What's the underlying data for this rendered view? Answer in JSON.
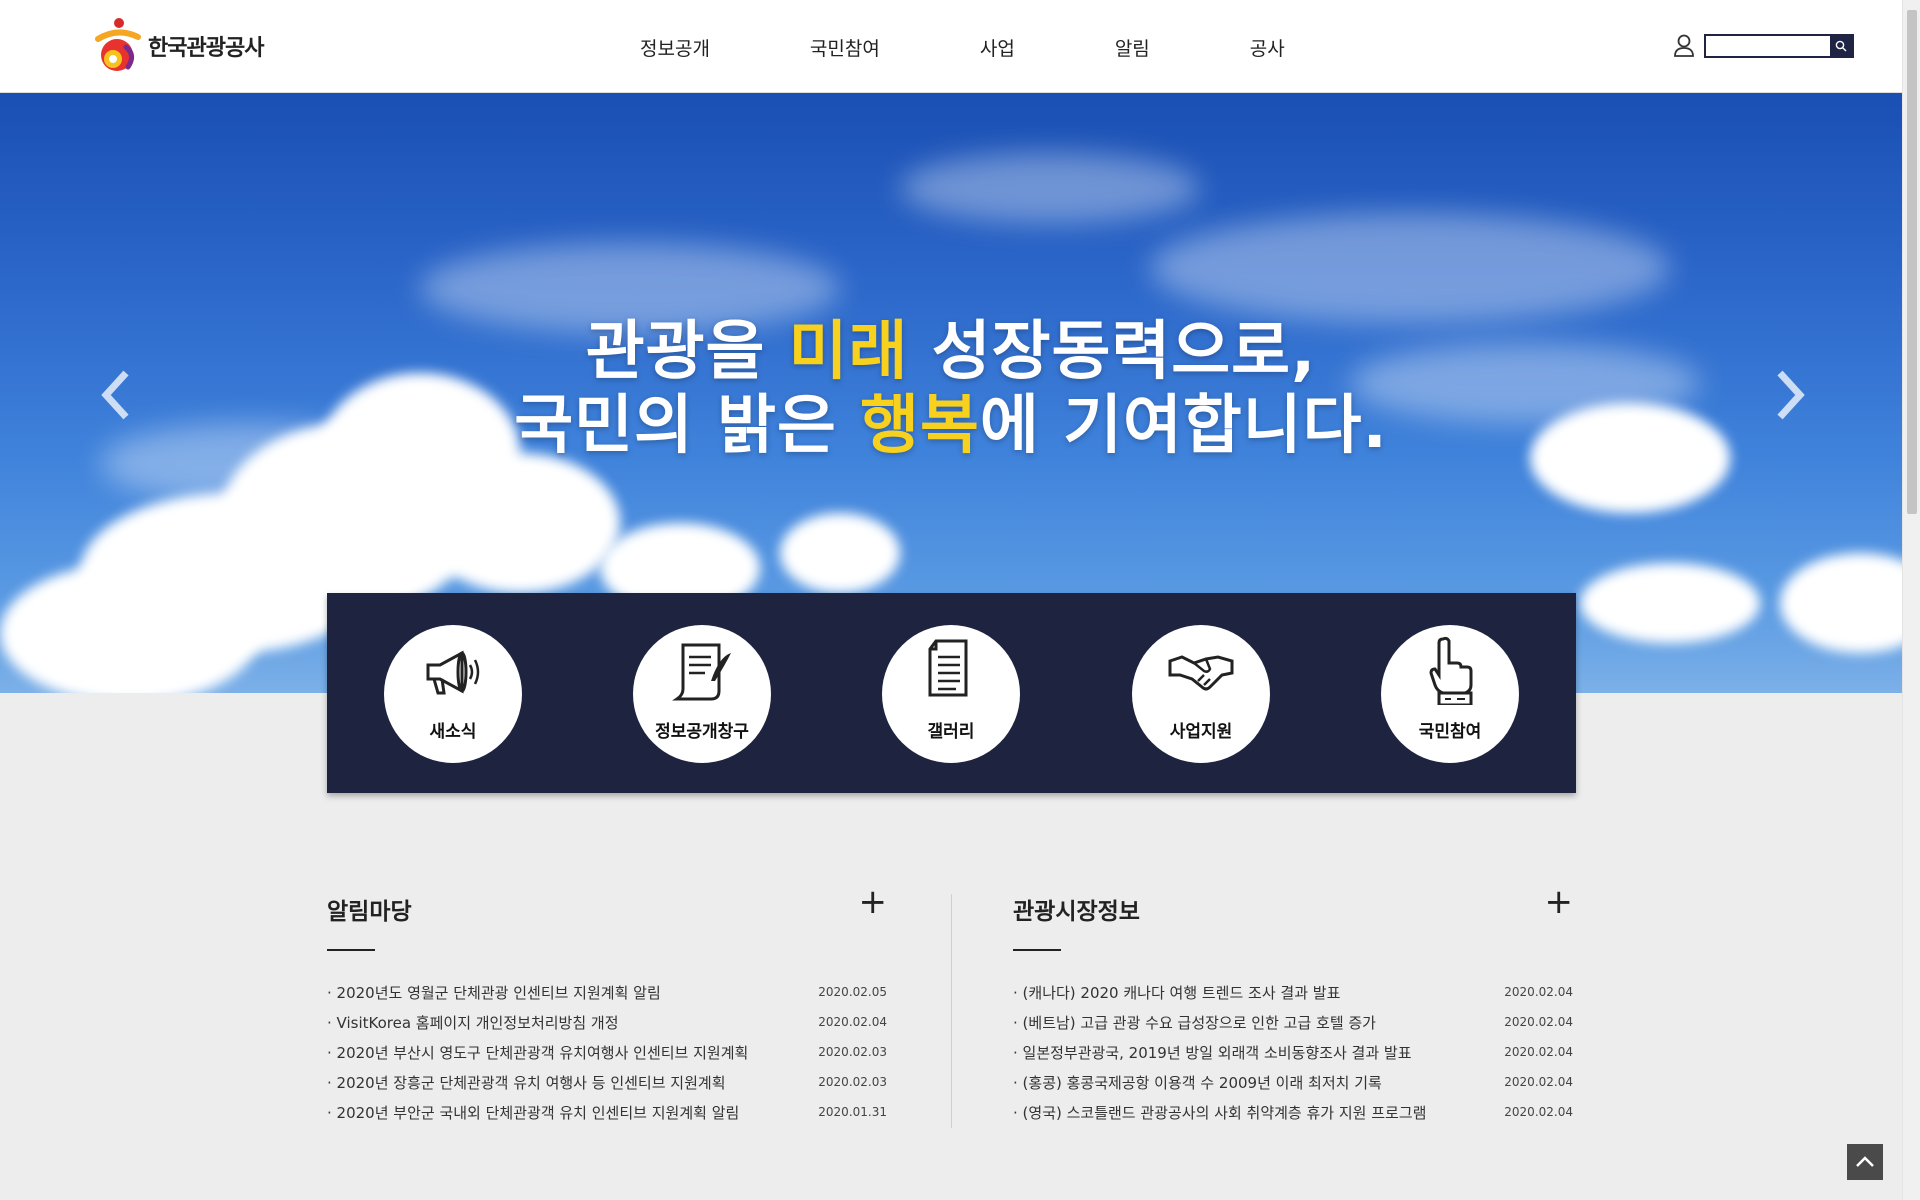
{
  "header": {
    "logo_text": "한국관광공사",
    "nav": [
      "정보공개",
      "국민참여",
      "사업",
      "알림",
      "공사"
    ],
    "search_placeholder": ""
  },
  "hero": {
    "line1_a": "관광을 ",
    "line1_hl": "미래",
    "line1_b": " 성장동력으로,",
    "line2_a": "국민의 밝은 ",
    "line2_hl": "행복",
    "line2_b": "에 기여합니다."
  },
  "quick_menu": [
    {
      "label": "새소식",
      "icon": "megaphone-icon"
    },
    {
      "label": "정보공개창구",
      "icon": "scroll-quill-icon"
    },
    {
      "label": "갤러리",
      "icon": "document-icon"
    },
    {
      "label": "사업지원",
      "icon": "handshake-icon"
    },
    {
      "label": "국민참여",
      "icon": "pointing-hand-icon"
    }
  ],
  "notice_board": {
    "title": "알림마당",
    "plus": "+",
    "items": [
      {
        "title": "· 2020년도 영월군 단체관광 인센티브 지원계획 알림",
        "date": "2020.02.05"
      },
      {
        "title": "· VisitKorea 홈페이지 개인정보처리방침 개정",
        "date": "2020.02.04"
      },
      {
        "title": "· 2020년 부산시 영도구 단체관광객 유치여행사 인센티브 지원계획",
        "date": "2020.02.03"
      },
      {
        "title": "· 2020년 장흥군 단체관광객 유치 여행사 등 인센티브 지원계획",
        "date": "2020.02.03"
      },
      {
        "title": "· 2020년 부안군 국내외 단체관광객 유치 인센티브 지원계획 알림",
        "date": "2020.01.31"
      }
    ]
  },
  "market_board": {
    "title": "관광시장정보",
    "plus": "+",
    "items": [
      {
        "title": "· (캐나다) 2020 캐나다 여행 트렌드 조사 결과 발표",
        "date": "2020.02.04"
      },
      {
        "title": "· (베트남) 고급 관광 수요 급성장으로 인한 고급 호텔 증가",
        "date": "2020.02.04"
      },
      {
        "title": "· 일본정부관광국, 2019년 방일 외래객 소비동향조사 결과 발표",
        "date": "2020.02.04"
      },
      {
        "title": "· (홍콩) 홍콩국제공항 이용객 수 2009년 이래 최저치 기록",
        "date": "2020.02.04"
      },
      {
        "title": "· (영국) 스코틀랜드 관광공사의 사회 취약계층 휴가 지원 프로그램",
        "date": "2020.02.04"
      }
    ]
  },
  "colors": {
    "navy": "#1e2340",
    "highlight": "#f7d11e"
  }
}
